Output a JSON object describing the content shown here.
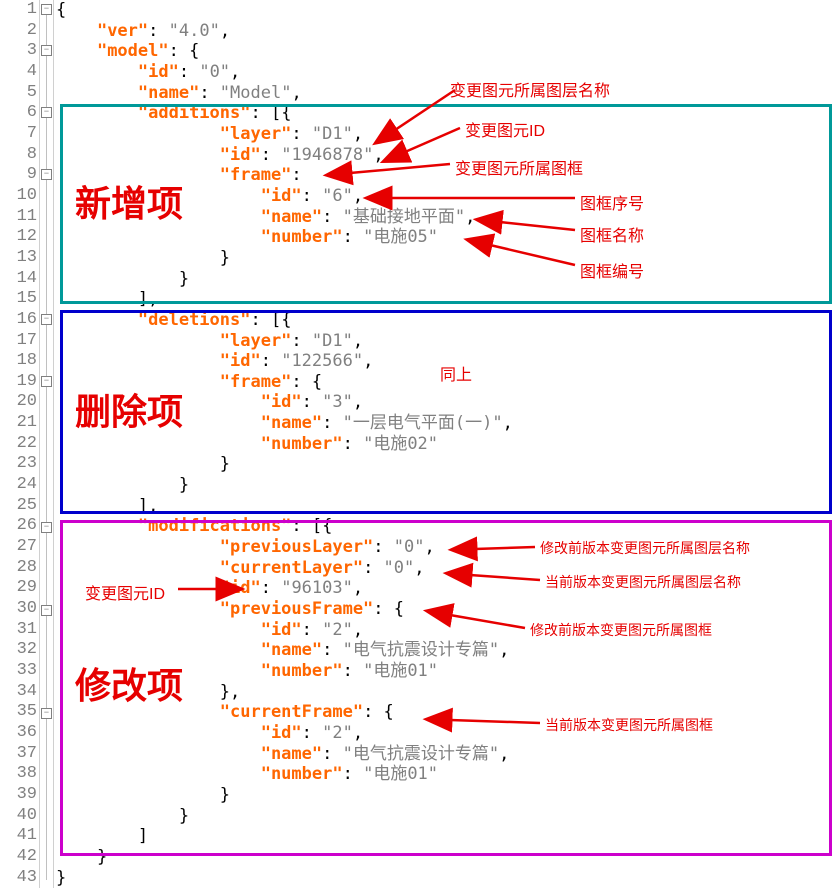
{
  "lines": [
    "1",
    "2",
    "3",
    "4",
    "5",
    "6",
    "7",
    "8",
    "9",
    "10",
    "11",
    "12",
    "13",
    "14",
    "15",
    "16",
    "17",
    "18",
    "19",
    "20",
    "21",
    "22",
    "23",
    "24",
    "25",
    "26",
    "27",
    "28",
    "29",
    "30",
    "31",
    "32",
    "33",
    "34",
    "35",
    "36",
    "37",
    "38",
    "39",
    "40",
    "41",
    "42",
    "43"
  ],
  "code": {
    "l1_p1": "{",
    "l2_k": "\"ver\"",
    "l2_p": ": ",
    "l2_v": "\"4.0\"",
    "l2_e": ",",
    "l3_k": "\"model\"",
    "l3_p": ": {",
    "l4_k": "\"id\"",
    "l4_p": ": ",
    "l4_v": "\"0\"",
    "l4_e": ",",
    "l5_k": "\"name\"",
    "l5_p": ": ",
    "l5_v": "\"Model\"",
    "l5_e": ",",
    "l6_k": "\"additions\"",
    "l6_p": ": [{",
    "l7_k": "\"layer\"",
    "l7_p": ": ",
    "l7_v": "\"D1\"",
    "l7_e": ",",
    "l8_k": "\"id\"",
    "l8_p": ": ",
    "l8_v": "\"1946878\"",
    "l8_e": ",",
    "l9_k": "\"frame\"",
    "l9_p": ":",
    "l10_k": "\"id\"",
    "l10_p": ": ",
    "l10_v": "\"6\"",
    "l10_e": ",",
    "l11_k": "\"name\"",
    "l11_p": ": ",
    "l11_v": "\"基础接地平面\"",
    "l11_e": ",",
    "l12_k": "\"number\"",
    "l12_p": ": ",
    "l12_v": "\"电施05\"",
    "l13": "}",
    "l14": "}",
    "l15": "],",
    "l16_k": "\"deletions\"",
    "l16_p": ": [{",
    "l17_k": "\"layer\"",
    "l17_p": ": ",
    "l17_v": "\"D1\"",
    "l17_e": ",",
    "l18_k": "\"id\"",
    "l18_p": ": ",
    "l18_v": "\"122566\"",
    "l18_e": ",",
    "l19_k": "\"frame\"",
    "l19_p": ": {",
    "l20_k": "\"id\"",
    "l20_p": ": ",
    "l20_v": "\"3\"",
    "l20_e": ",",
    "l21_k": "\"name\"",
    "l21_p": ": ",
    "l21_v": "\"一层电气平面(一)\"",
    "l21_e": ",",
    "l22_k": "\"number\"",
    "l22_p": ": ",
    "l22_v": "\"电施02\"",
    "l23": "}",
    "l24": "}",
    "l25": "],",
    "l26_k": "\"modifications\"",
    "l26_p": ": [{",
    "l27_k": "\"previousLayer\"",
    "l27_p": ": ",
    "l27_v": "\"0\"",
    "l27_e": ",",
    "l28_k": "\"currentLayer\"",
    "l28_p": ": ",
    "l28_v": "\"0\"",
    "l28_e": ",",
    "l29_k": "\"id\"",
    "l29_p": ": ",
    "l29_v": "\"96103\"",
    "l29_e": ",",
    "l30_k": "\"previousFrame\"",
    "l30_p": ": {",
    "l31_k": "\"id\"",
    "l31_p": ": ",
    "l31_v": "\"2\"",
    "l31_e": ",",
    "l32_k": "\"name\"",
    "l32_p": ": ",
    "l32_v": "\"电气抗震设计专篇\"",
    "l32_e": ",",
    "l33_k": "\"number\"",
    "l33_p": ": ",
    "l33_v": "\"电施01\"",
    "l34": "},",
    "l35_k": "\"currentFrame\"",
    "l35_p": ": {",
    "l36_k": "\"id\"",
    "l36_p": ": ",
    "l36_v": "\"2\"",
    "l36_e": ",",
    "l37_k": "\"name\"",
    "l37_p": ": ",
    "l37_v": "\"电气抗震设计专篇\"",
    "l37_e": ",",
    "l38_k": "\"number\"",
    "l38_p": ": ",
    "l38_v": "\"电施01\"",
    "l39": "}",
    "l40": "}",
    "l41": "]",
    "l42": "}",
    "l43": "}"
  },
  "sections": {
    "additions": "新增项",
    "deletions": "删除项",
    "modifications": "修改项"
  },
  "anno": {
    "a1": "变更图元所属图层名称",
    "a2": "变更图元ID",
    "a3": "变更图元所属图框",
    "a4": "图框序号",
    "a5": "图框名称",
    "a6": "图框编号",
    "a7": "同上",
    "a8": "变更图元ID",
    "a9": "修改前版本变更图元所属图层名称",
    "a10": "当前版本变更图元所属图层名称",
    "a11": "修改前版本变更图元所属图框",
    "a12": "当前版本变更图元所属图框"
  }
}
